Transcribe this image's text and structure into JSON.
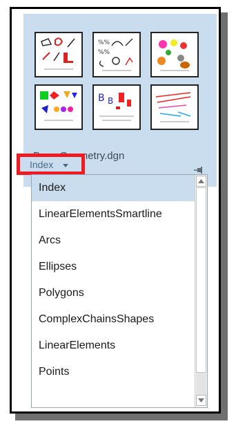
{
  "document": {
    "filename": "Base Geometry.dgn",
    "selected_view": "Index"
  },
  "icons": {
    "pin": "pin-icon",
    "dropdown_caret": "chevron-down-icon",
    "scroll_up": "arrow-up-icon",
    "scroll_down": "arrow-down-icon"
  },
  "colors": {
    "card_bg": "#c9ddef",
    "highlight": "#ee1b22",
    "selected_item_bg": "#c9ddef"
  },
  "dropdown": {
    "items": [
      "Index",
      "LinearElementsSmartline",
      "Arcs",
      "Ellipses",
      "Polygons",
      "ComplexChainsShapes",
      "LinearElements",
      "Points"
    ]
  }
}
